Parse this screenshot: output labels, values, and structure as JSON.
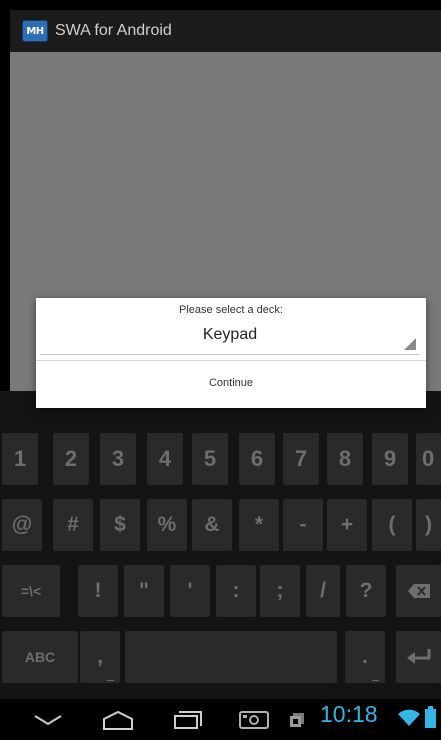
{
  "app": {
    "icon_label": "MH",
    "title": "SWA for Android"
  },
  "dialog": {
    "prompt": "Please select a deck:",
    "selected_deck": "Keypad",
    "continue_label": "Continue"
  },
  "keyboard": {
    "row1": [
      "1",
      "2",
      "3",
      "4",
      "5",
      "6",
      "7",
      "8",
      "9",
      "0"
    ],
    "row2": [
      "@",
      "#",
      "$",
      "%",
      "&",
      "*",
      "-",
      "+",
      "(",
      ")"
    ],
    "row3": [
      "=\\<",
      "!",
      "\"",
      "'",
      ":",
      ";",
      "/",
      "?"
    ],
    "row4": {
      "abc_label": "ABC",
      "comma": ",",
      "period": "."
    }
  },
  "status": {
    "time": "10:18"
  },
  "colors": {
    "accent": "#33b5e5",
    "dim_overlay": "#7a7a7a",
    "app_icon": "#2f6db5"
  },
  "icons": [
    "back-icon",
    "home-icon",
    "recent-apps-icon",
    "screenshot-icon",
    "notification-icon",
    "wifi-icon",
    "battery-icon",
    "delete-icon",
    "enter-icon",
    "spinner-arrow-icon"
  ]
}
